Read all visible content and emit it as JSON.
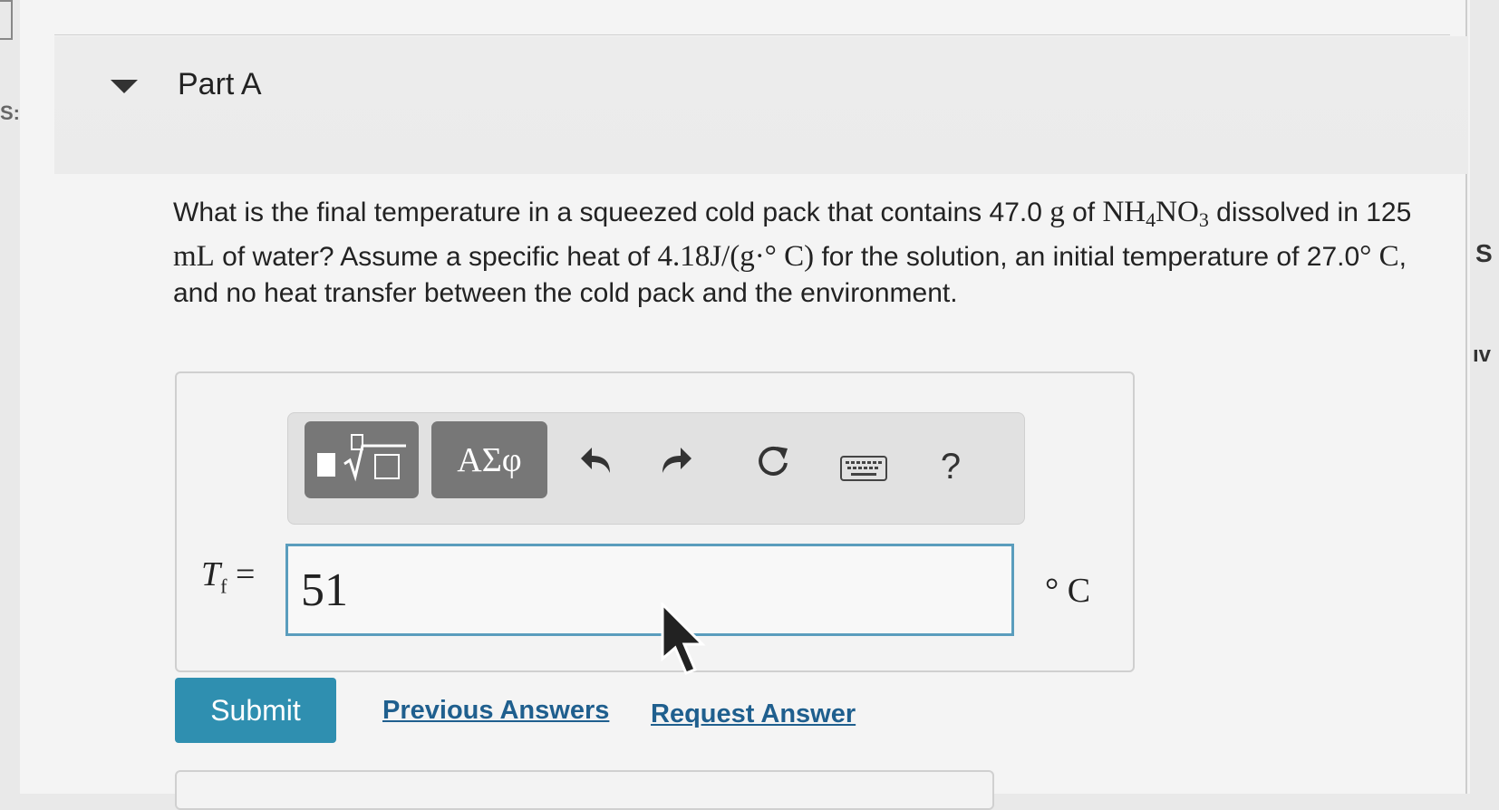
{
  "part": {
    "title": "Part A"
  },
  "question": {
    "s1": "What is the final temperature in a squeezed cold pack that contains 47.0",
    "m1": "g",
    "s2": "of",
    "m2a": "NH",
    "m2b": "4",
    "m2c": "NO",
    "m2d": "3",
    "s3": "dissolved in 125",
    "m3": "mL",
    "s4": "of water? Assume a specific heat of",
    "m4": "4.18J/(g·° C)",
    "s5": "for the solution, an initial temperature of 27.0",
    "m5": "° C",
    "s6": ", and no heat transfer between the cold pack and the environment."
  },
  "toolbar": {
    "template_label": "▪√▫",
    "greek_label": "ΑΣφ",
    "help_label": "?"
  },
  "answer": {
    "var_main": "T",
    "var_sub": "f",
    "equals": "=",
    "value": "51",
    "unit": "° C"
  },
  "actions": {
    "submit": "Submit",
    "previous_answers": "Previous Answers",
    "request_answer": "Request Answer"
  },
  "edge": {
    "right_s": "S",
    "right_iv": "ıv",
    "left_s": "S:"
  }
}
